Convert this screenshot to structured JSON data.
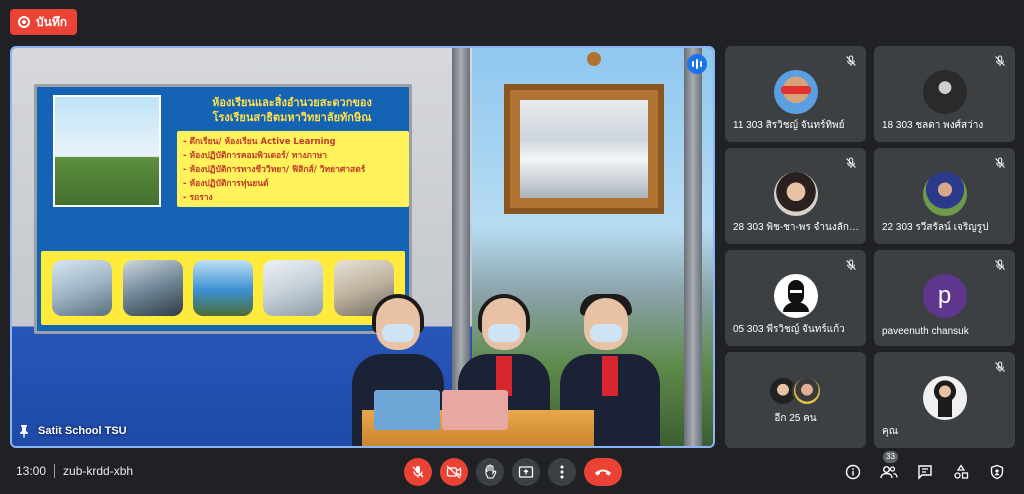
{
  "record": {
    "label": "บันทึก"
  },
  "stage": {
    "presenter_label": "Satit School TSU",
    "slide": {
      "title": "ห้องเรียนและสิ่งอำนวยสะดวกของ โรงเรียนสาธิตมหาวิทยาลัยทักษิณ",
      "items": [
        "- ตึกเรียน/ ห้องเรียน Active Learning",
        "- ห้องปฏิบัติการคอมพิวเตอร์/ ทางภาษา",
        "- ห้องปฏิบัติการทางชีววิทยา/ ฟิสิกส์/ วิทยาศาสตร์",
        "- ห้องปฏิบัติการหุ่นยนต์",
        "- รถราง"
      ]
    }
  },
  "participants": [
    {
      "name": "11 303 สิรวิชญ์ จันทร์ทิพย์",
      "avatar": "dog-photo",
      "muted": true
    },
    {
      "name": "18 303 ชลดา พงศ์สว่าง",
      "avatar": "person-photo-dark",
      "muted": true
    },
    {
      "name": "28 303 พิช-ชา-พร จำนงลักษ...",
      "avatar": "person-photo-light",
      "muted": true
    },
    {
      "name": "22 303 รวีสรัลน์ เจริญรูป",
      "avatar": "person-photo-outdoor",
      "muted": true
    },
    {
      "name": "05 303 พีรวิชญ์ จันทร์แก้ว",
      "avatar": "masked-figure",
      "muted": true
    },
    {
      "name": "paveenuth chansuk",
      "avatar_letter": "p",
      "muted": true
    },
    {
      "name": "อีก 25 คน",
      "avatar": "group-avatars",
      "muted": false
    },
    {
      "name": "คุณ",
      "avatar": "self-photo",
      "muted": true
    }
  ],
  "bottom_bar": {
    "time": "13:00",
    "meeting_code": "zub-krdd-xbh",
    "people_count": "33"
  },
  "colors": {
    "background": "#202124",
    "tile": "#3c4043",
    "danger": "#ea4335",
    "active_border": "#8ab4f8",
    "letter_avatar": "#5f368d"
  }
}
